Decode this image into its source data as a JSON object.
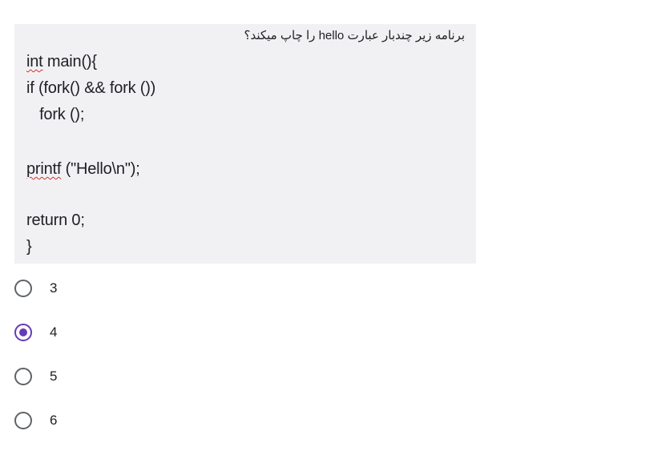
{
  "question": {
    "title": "برنامه زیر چندبار عبارت hello را چاپ میکند؟",
    "code": {
      "line1_kw": "int",
      "line1_rest": " main(){",
      "line2": "if (fork() && fork ())",
      "line3": "   fork ();",
      "line4_fn": "printf",
      "line4_rest": " (\"Hello\\n\");",
      "line5": "return 0;",
      "line6": "}"
    }
  },
  "options": [
    {
      "label": "3",
      "selected": false
    },
    {
      "label": "4",
      "selected": true
    },
    {
      "label": "5",
      "selected": false
    },
    {
      "label": "6",
      "selected": false
    }
  ],
  "colors": {
    "accent": "#673ab7",
    "card_background": "#f1f1f4",
    "spellcheck": "#d93025"
  }
}
